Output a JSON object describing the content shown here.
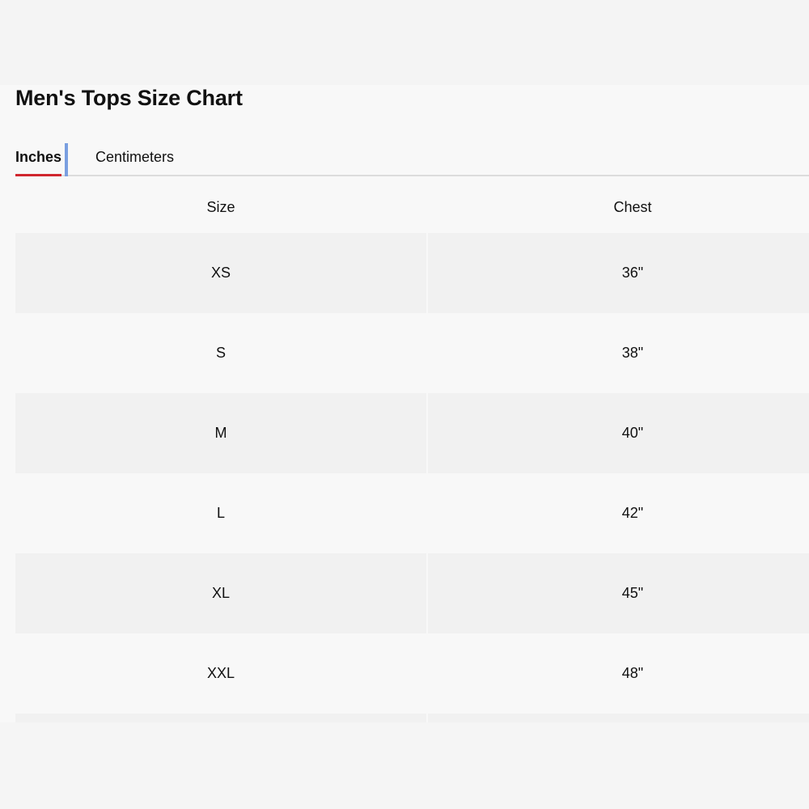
{
  "title": "Men's Tops Size Chart",
  "tabs": [
    {
      "label": "Inches",
      "active": true
    },
    {
      "label": "Centimeters",
      "active": false
    }
  ],
  "colors": {
    "active_tab_underline": "#d0262e",
    "focus_indicator": "#7a9fe0",
    "row_shade": "#f1f1f1",
    "background": "#f8f8f8"
  },
  "table": {
    "headers": [
      "Size",
      "Chest"
    ],
    "rows": [
      {
        "size": "XS",
        "chest": "36\""
      },
      {
        "size": "S",
        "chest": "38\""
      },
      {
        "size": "M",
        "chest": "40\""
      },
      {
        "size": "L",
        "chest": "42\""
      },
      {
        "size": "XL",
        "chest": "45\""
      },
      {
        "size": "XXL",
        "chest": "48\""
      }
    ]
  }
}
